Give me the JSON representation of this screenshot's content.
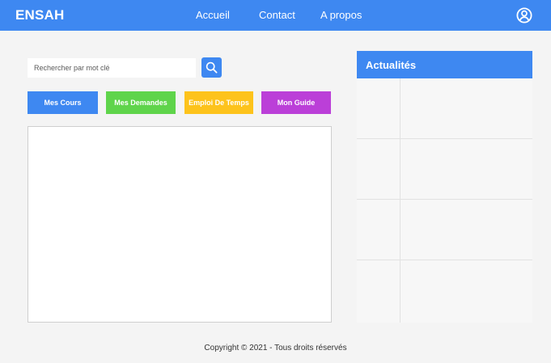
{
  "header": {
    "brand": "ENSAH",
    "nav": {
      "accueil": "Accueil",
      "contact": "Contact",
      "apropos": "A propos"
    },
    "user_icon": "user-circle-icon"
  },
  "search": {
    "placeholder": "Rechercher par mot clé",
    "icon": "search-icon"
  },
  "actions": {
    "cours": "Mes Cours",
    "demandes": "Mes Demandes",
    "emploi": "Emploi De Temps",
    "guide": "Mon Guide"
  },
  "news": {
    "title": "Actualités"
  },
  "footer": {
    "copyright": "Copyright © 2021 - Tous droits réservés"
  },
  "colors": {
    "primary": "#3e88f1",
    "cours": "#3e88f1",
    "demandes": "#5fd44b",
    "emploi": "#fdc31c",
    "guide": "#bb3fd8",
    "background": "#f4f4f4"
  }
}
